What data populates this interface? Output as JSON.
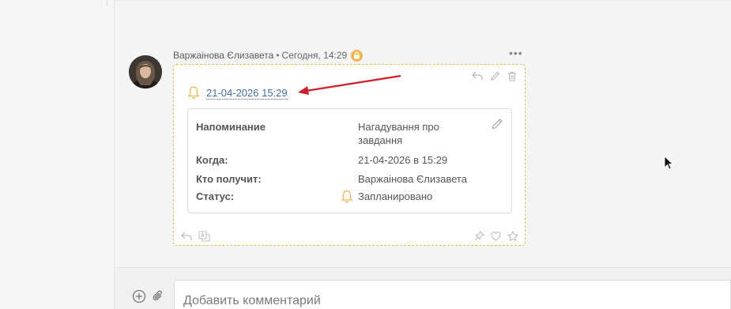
{
  "post": {
    "author": "Варжаінова Єлизавета",
    "separator": "•",
    "time": "Сегодня, 14:29",
    "more_label": "•••"
  },
  "reminder": {
    "date_link": "21-04-2026 15:29",
    "fields": [
      {
        "key": "Напоминание",
        "value": "Нагадування про завдання"
      },
      {
        "key": "Когда:",
        "value": "21-04-2026 в 15:29"
      },
      {
        "key": "Кто получит:",
        "value": "Варжаінова Єлизавета"
      },
      {
        "key": "Статус:",
        "value": "Запланировано"
      }
    ]
  },
  "composer": {
    "placeholder": "Добавить комментарий"
  },
  "colors": {
    "accent_orange": "#f0b84a",
    "link_blue": "#3e6fa8",
    "arrow_red": "#d0202a"
  },
  "icons": [
    "lock-icon",
    "reply-icon",
    "edit-icon",
    "trash-icon",
    "bell-icon",
    "translate-icon",
    "pin-icon",
    "heart-icon",
    "star-icon",
    "add-icon",
    "attach-icon"
  ]
}
